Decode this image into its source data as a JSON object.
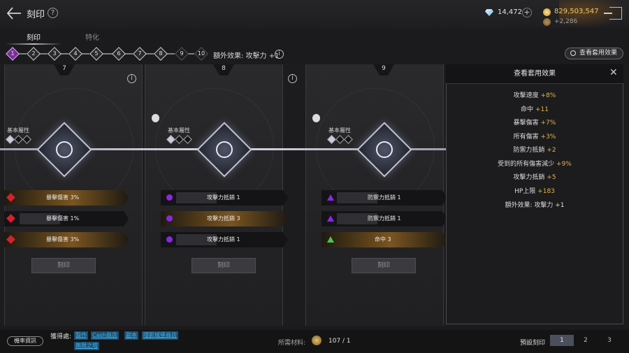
{
  "header": {
    "title": "刻印",
    "help_label": "?",
    "diamonds": "14,472",
    "add_label": "+",
    "gold": "829,503,547",
    "sub_gold": "+2,286"
  },
  "tabs": [
    {
      "label": "刻印",
      "active": true
    },
    {
      "label": "特化",
      "active": false
    }
  ],
  "levels": [
    "1",
    "2",
    "3",
    "4",
    "5",
    "6",
    "7",
    "8",
    "9",
    "10"
  ],
  "current_level": "1",
  "bonus_effect": "額外效果: 攻擊力 +1",
  "view_button": "查看套用效果",
  "panels": [
    {
      "number": "7",
      "base_label": "基本屬性",
      "rows": [
        {
          "icon": "red-diamond-icon",
          "text": "暴擊傷害 3%",
          "style": "gold"
        },
        {
          "icon": "red-diamond-icon",
          "text": "暴擊傷害 1%",
          "style": "dark"
        },
        {
          "icon": "red-diamond-icon",
          "text": "暴擊傷害 3%",
          "style": "gold"
        }
      ],
      "button": "刻印"
    },
    {
      "number": "8",
      "base_label": "基本屬性",
      "rows": [
        {
          "icon": "purple-circle-icon",
          "text": "攻擊力抵銷 1",
          "style": "dark"
        },
        {
          "icon": "purple-circle-icon",
          "text": "攻擊力抵銷 3",
          "style": "gold"
        },
        {
          "icon": "purple-circle-icon",
          "text": "攻擊力抵銷 1",
          "style": "dark"
        }
      ],
      "button": "刻印"
    },
    {
      "number": "9",
      "base_label": "基本屬性",
      "rows": [
        {
          "icon": "purple-triangle-icon",
          "text": "防禦力抵銷 1",
          "style": "dark"
        },
        {
          "icon": "purple-triangle-icon",
          "text": "防禦力抵銷 1",
          "style": "dark"
        },
        {
          "icon": "green-triangle-icon",
          "text": "命中 3",
          "style": "gold"
        }
      ],
      "button": "刻印"
    }
  ],
  "effects_panel": {
    "title": "查看套用效果",
    "close_label": "✕",
    "effects": [
      {
        "name": "攻擊速度",
        "value": "+8%"
      },
      {
        "name": "命中",
        "value": "+11"
      },
      {
        "name": "暴擊傷害",
        "value": "+7%"
      },
      {
        "name": "所有傷害",
        "value": "+3%"
      },
      {
        "name": "防禦力抵銷",
        "value": "+2"
      },
      {
        "name": "受到的所有傷害減少",
        "value": "+9%"
      },
      {
        "name": "攻擊力抵銷",
        "value": "+5"
      },
      {
        "name": "HP上限",
        "value": "+183"
      },
      {
        "name": "額外效果: 攻擊力 +1",
        "value": ""
      }
    ]
  },
  "footer": {
    "prob_button": "機率資訊",
    "obtain_label": "獲得處:",
    "links": [
      "製作",
      "Cash商店",
      "副本",
      "隱影城堡商店",
      "無限之塔"
    ],
    "material_label": "所需材料:",
    "material_value": "107 / 1",
    "preset_label": "預設刻印",
    "presets": [
      "1",
      "2",
      "3"
    ],
    "selected_preset": "1"
  },
  "colors": {
    "accent_gold": "#e3b347",
    "active_level": "#7a2e9a",
    "link": "#3fb4f2"
  }
}
